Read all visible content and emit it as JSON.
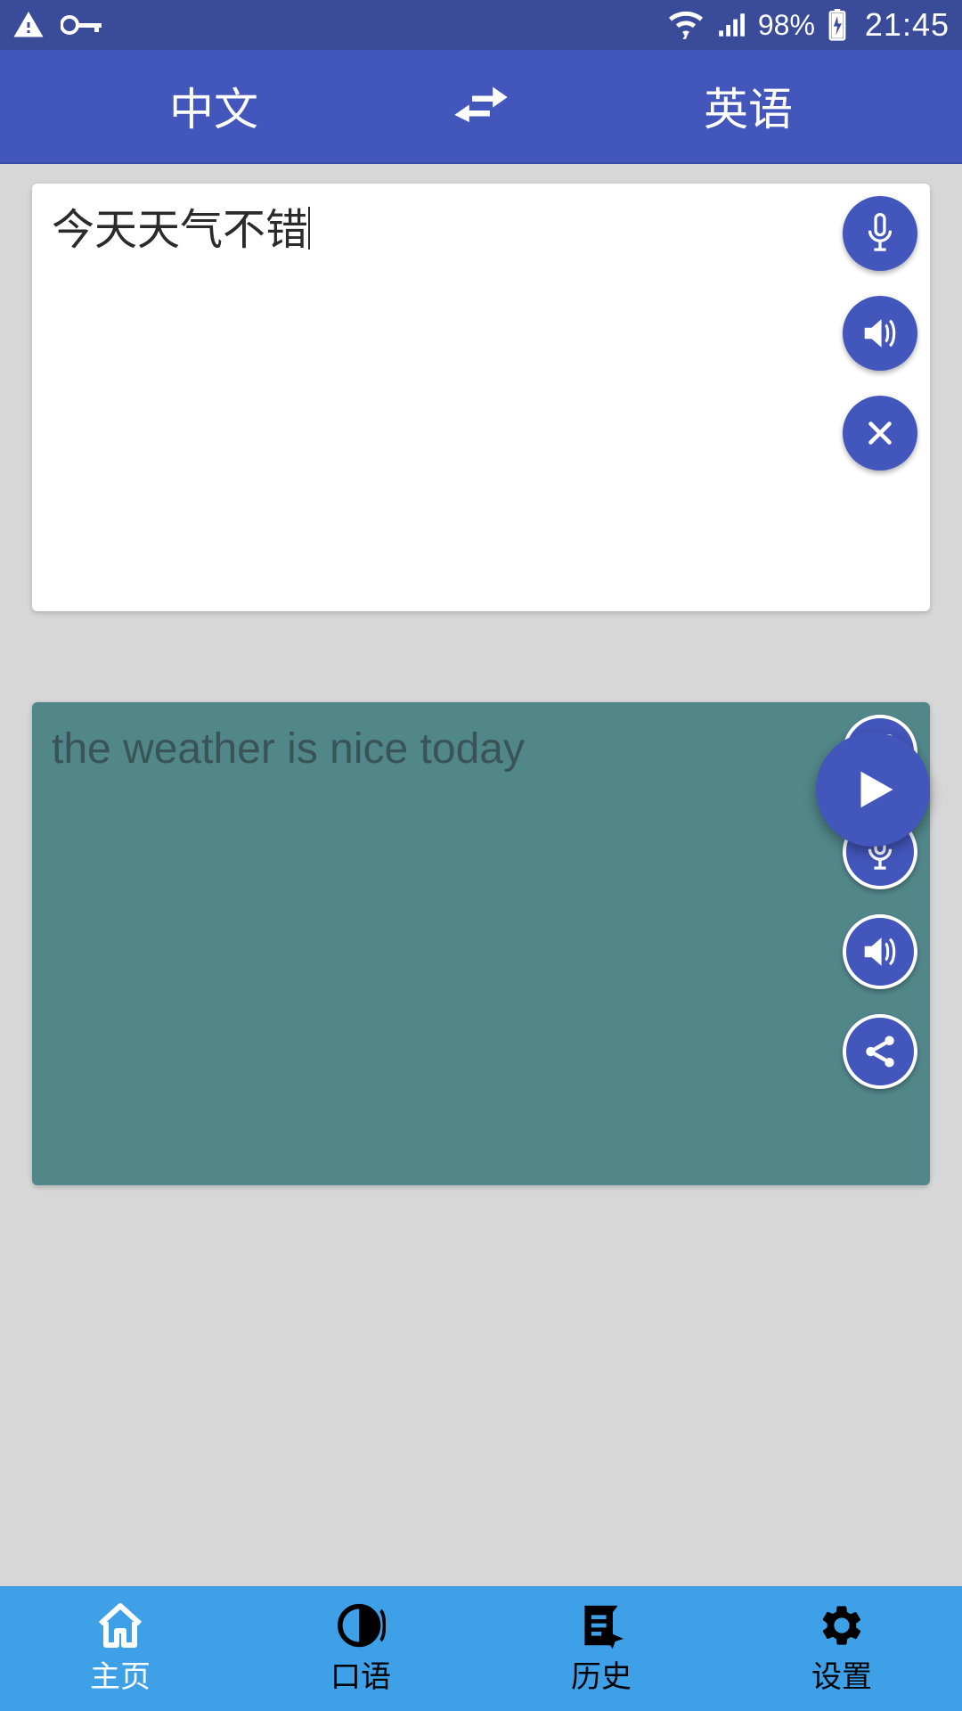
{
  "status": {
    "battery_pct": "98%",
    "time": "21:45"
  },
  "header": {
    "source_lang": "中文",
    "target_lang": "英语"
  },
  "input": {
    "text": "今天天气不错"
  },
  "output": {
    "text": "the weather is nice today"
  },
  "nav": {
    "home": "主页",
    "speech": "口语",
    "history": "历史",
    "settings": "设置"
  },
  "icons": {
    "warning": "warning-icon",
    "key": "key-icon",
    "wifi": "wifi-icon",
    "signal": "signal-icon",
    "battery": "battery-charging-icon",
    "swap": "swap-icon",
    "mic": "microphone-icon",
    "speaker": "speaker-icon",
    "close": "close-icon",
    "play": "play-icon",
    "copy": "copy-icon",
    "share": "share-icon",
    "home": "home-icon",
    "speech": "speech-icon",
    "history": "history-icon",
    "settings": "settings-icon"
  }
}
